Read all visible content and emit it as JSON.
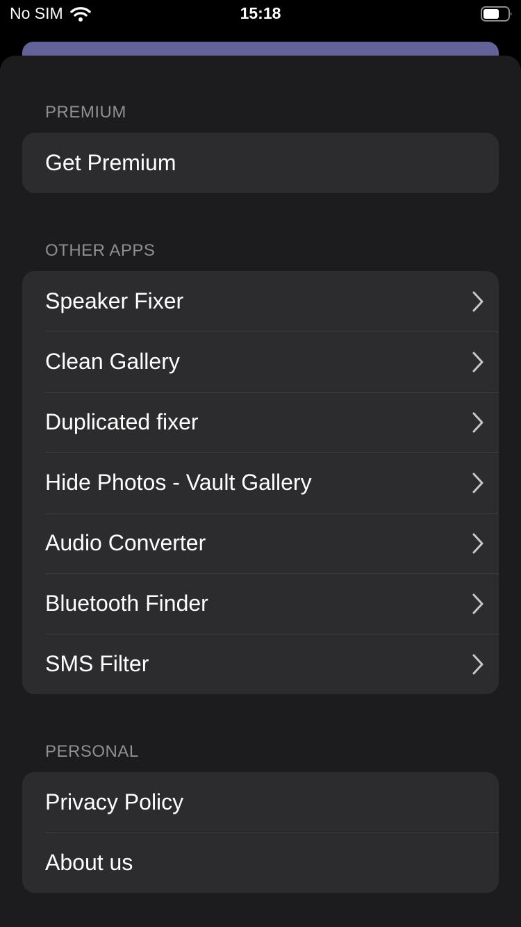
{
  "status_bar": {
    "carrier": "No SIM",
    "time": "15:18"
  },
  "sections": {
    "premium": {
      "header": "PREMIUM",
      "items": [
        {
          "label": "Get Premium"
        }
      ]
    },
    "other_apps": {
      "header": "OTHER APPS",
      "items": [
        {
          "label": "Speaker Fixer"
        },
        {
          "label": "Clean Gallery"
        },
        {
          "label": "Duplicated fixer"
        },
        {
          "label": "Hide Photos - Vault Gallery"
        },
        {
          "label": "Audio Converter"
        },
        {
          "label": "Bluetooth Finder"
        },
        {
          "label": "SMS Filter"
        }
      ]
    },
    "personal": {
      "header": "PERSONAL",
      "items": [
        {
          "label": "Privacy Policy"
        },
        {
          "label": "About us"
        }
      ]
    }
  },
  "colors": {
    "sheet_background": "#1c1c1e",
    "group_background": "#2c2c2e",
    "section_header": "#8e8e93",
    "accent_card": "#63639a"
  },
  "icons": {
    "status": [
      "wifi-icon",
      "battery-icon"
    ],
    "row_accessory": "chevron-right-icon"
  }
}
